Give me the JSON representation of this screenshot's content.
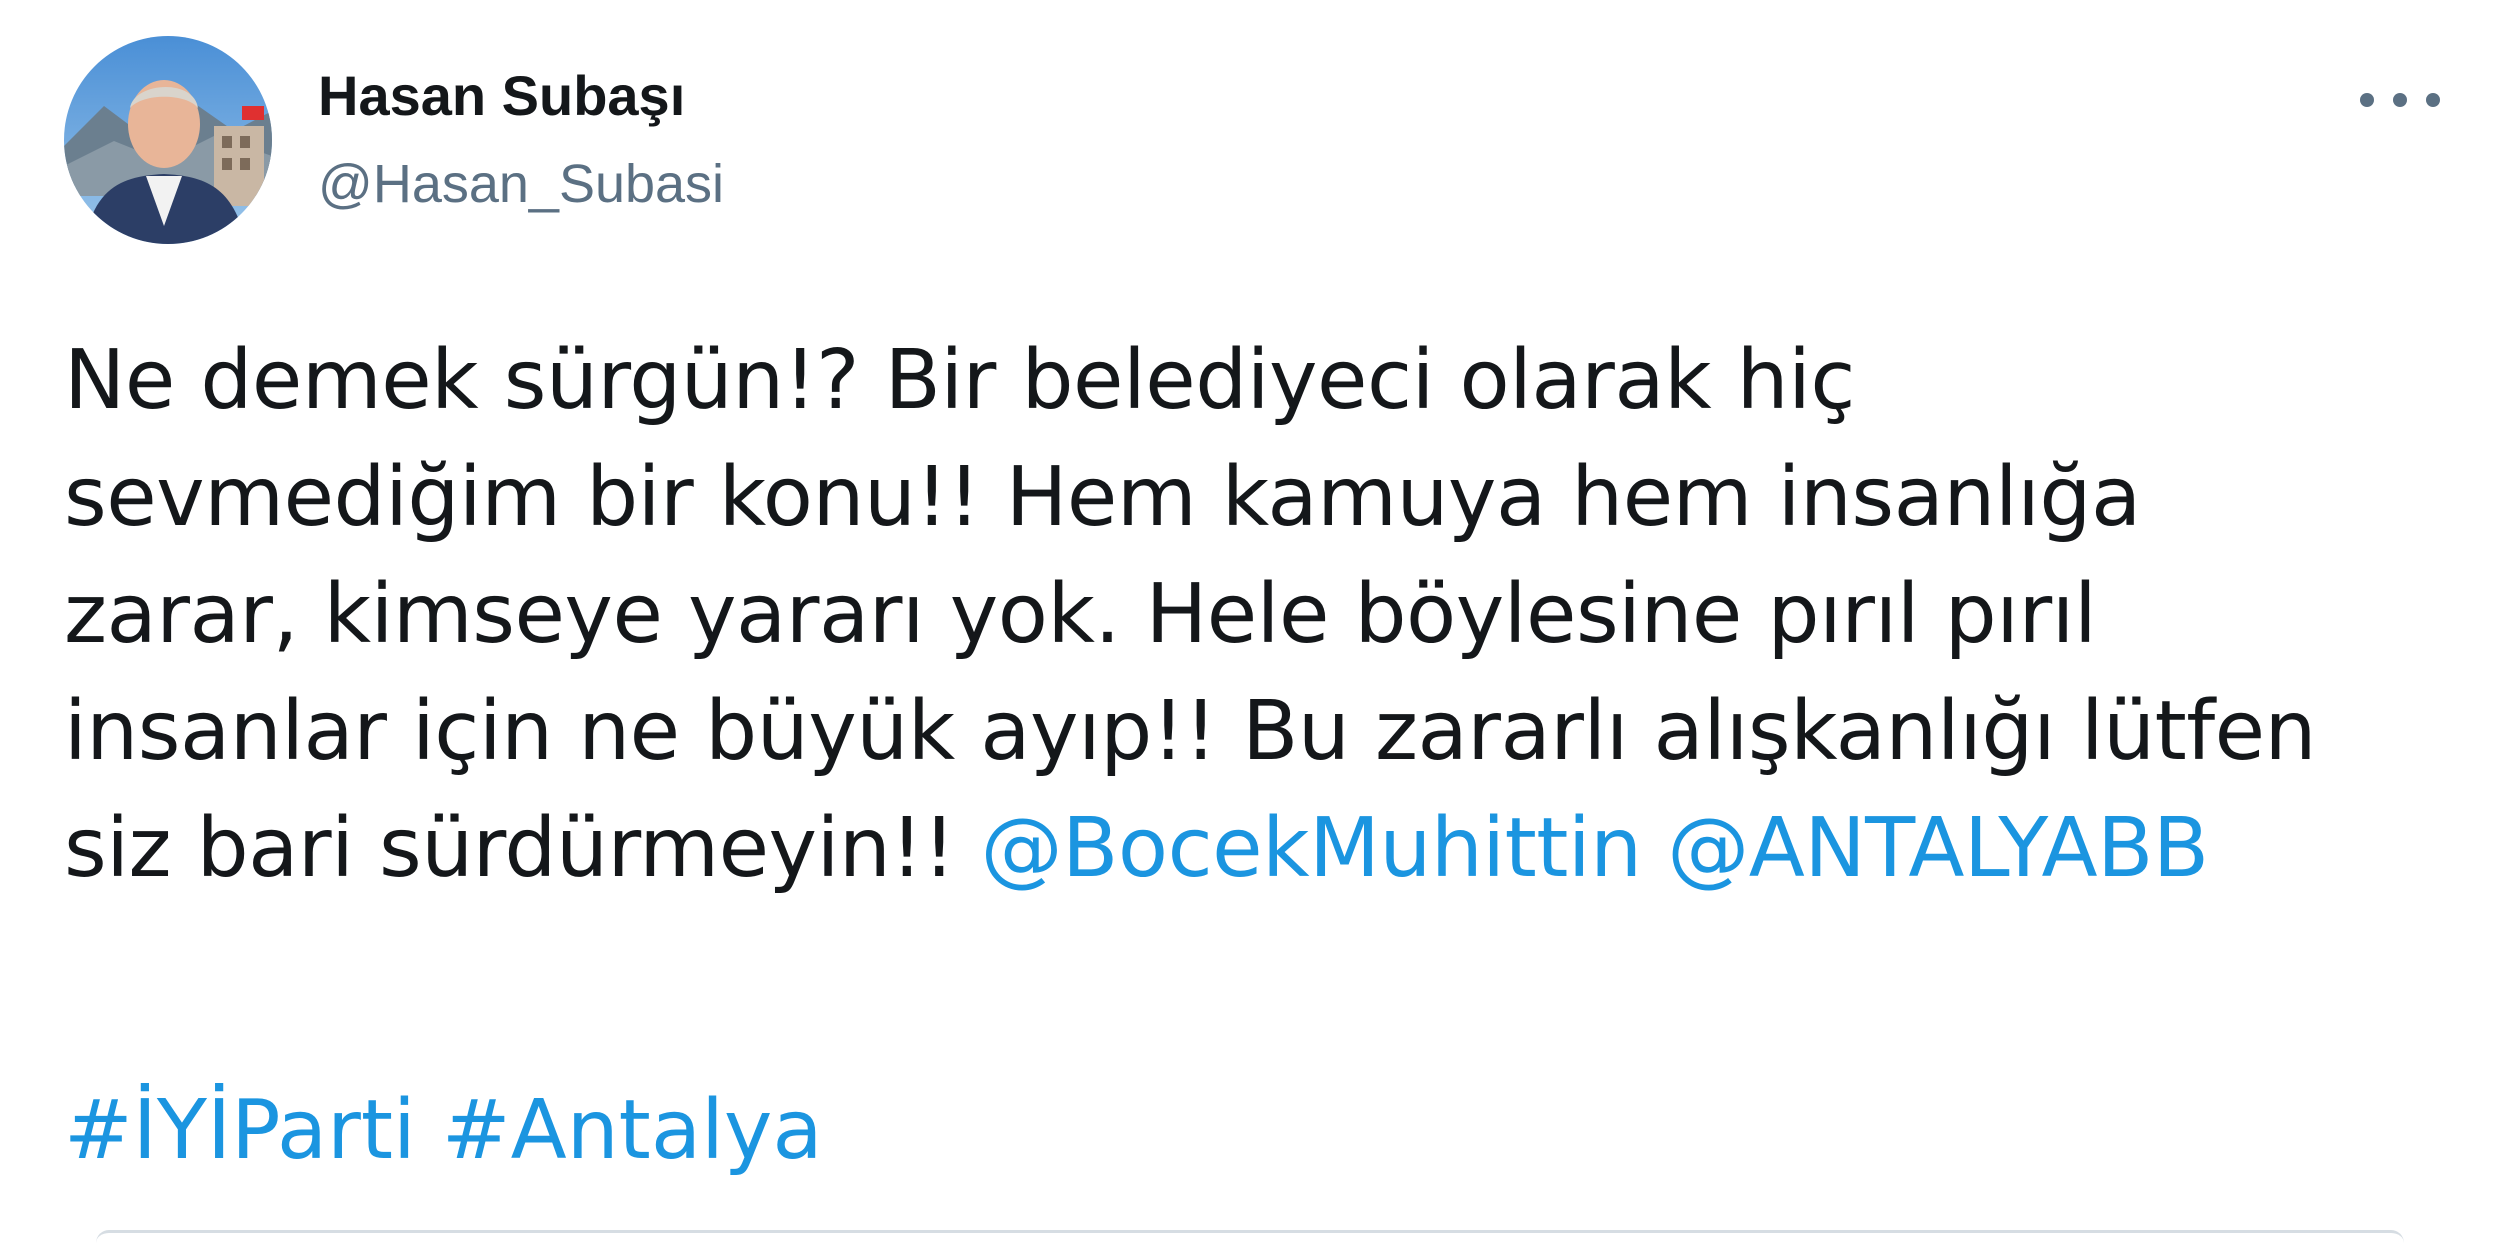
{
  "author": {
    "display_name": "Hasan Subaşı",
    "handle": "@Hasan_Subasi",
    "avatar_icon": "profile-photo"
  },
  "more_icon": "more-dots-icon",
  "tweet": {
    "lines": [
      "Ne demek sürgün!? Bir belediyeci olarak hiç",
      "sevmediğim bir konu!! Hem kamuya hem insanlığa",
      "zarar, kimseye yararı yok. Hele böylesine pırıl pırıl",
      "insanlar için ne büyük ayıp!! Bu zararlı alışkanlığı lütfen"
    ],
    "last_line_text": "siz bari sürdürmeyin!! ",
    "mentions": [
      "@BocekMuhittin",
      "@ANTALYABB"
    ],
    "hashtags": [
      "#İYİParti",
      "#Antalya"
    ]
  },
  "colors": {
    "text": "#14171a",
    "secondary": "#5b7083",
    "link": "#1b95e0"
  }
}
